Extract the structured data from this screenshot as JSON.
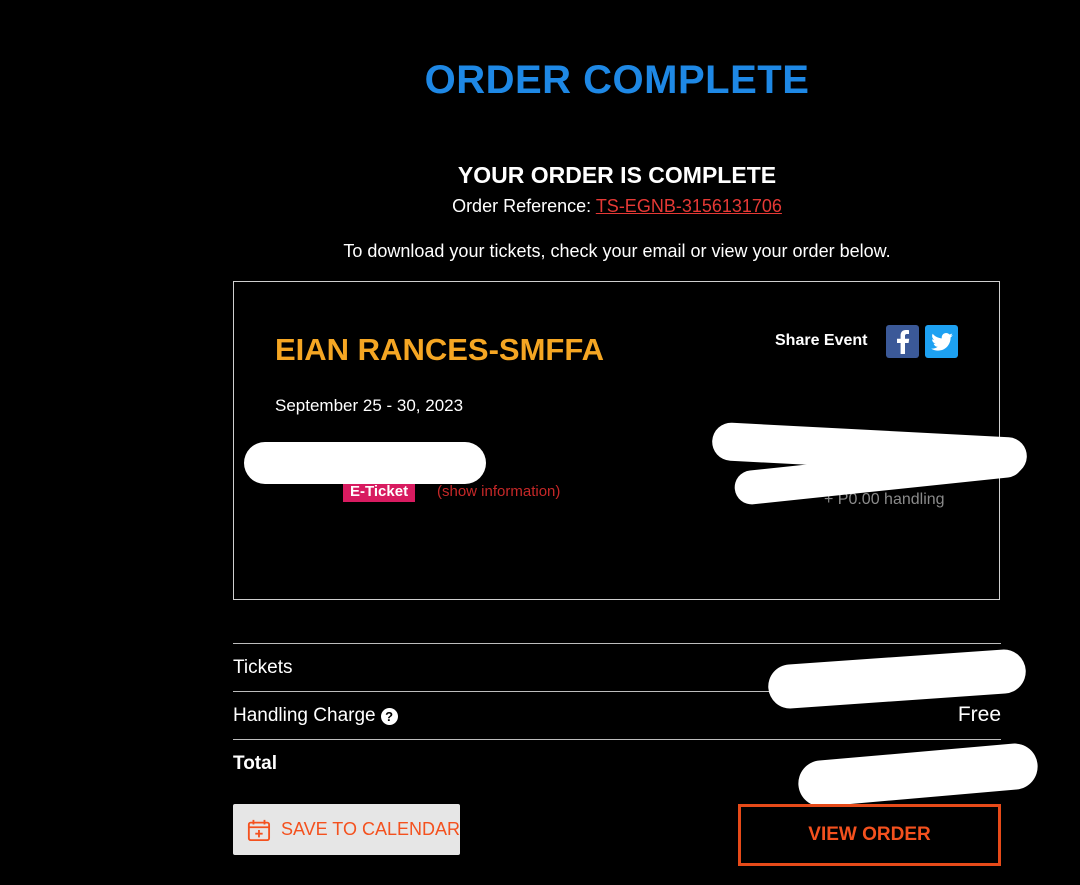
{
  "header": {
    "title": "ORDER COMPLETE"
  },
  "confirmation": {
    "heading": "YOUR ORDER IS COMPLETE",
    "reference_label": "Order Reference:",
    "reference_value": "TS-EGNB-3156131706",
    "instructions": "To download your tickets, check your email or view your order below."
  },
  "event": {
    "name": "EIAN RANCES-SMFFA",
    "share_label": "Share Event",
    "date": "September 25 - 30, 2023",
    "ticket_type": "E-Ticket",
    "show_info_link": "(show information)",
    "handling_text": "+ P0.00 handling"
  },
  "summary": {
    "rows": [
      {
        "label": "Tickets",
        "value": ""
      },
      {
        "label": "Handling Charge",
        "value": "Free"
      },
      {
        "label": "Total",
        "value": ""
      }
    ]
  },
  "actions": {
    "calendar_label": "SAVE TO CALENDAR",
    "view_order_label": "VIEW ORDER"
  },
  "icons": {
    "facebook": "facebook-icon",
    "twitter": "twitter-icon",
    "help": "help-circle-icon",
    "calendar": "calendar-add-icon"
  },
  "colors": {
    "title_blue": "#1e88e5",
    "event_orange": "#f5a623",
    "link_red": "#e53935",
    "badge_pink": "#d81b60",
    "button_orange": "#f4511e"
  }
}
